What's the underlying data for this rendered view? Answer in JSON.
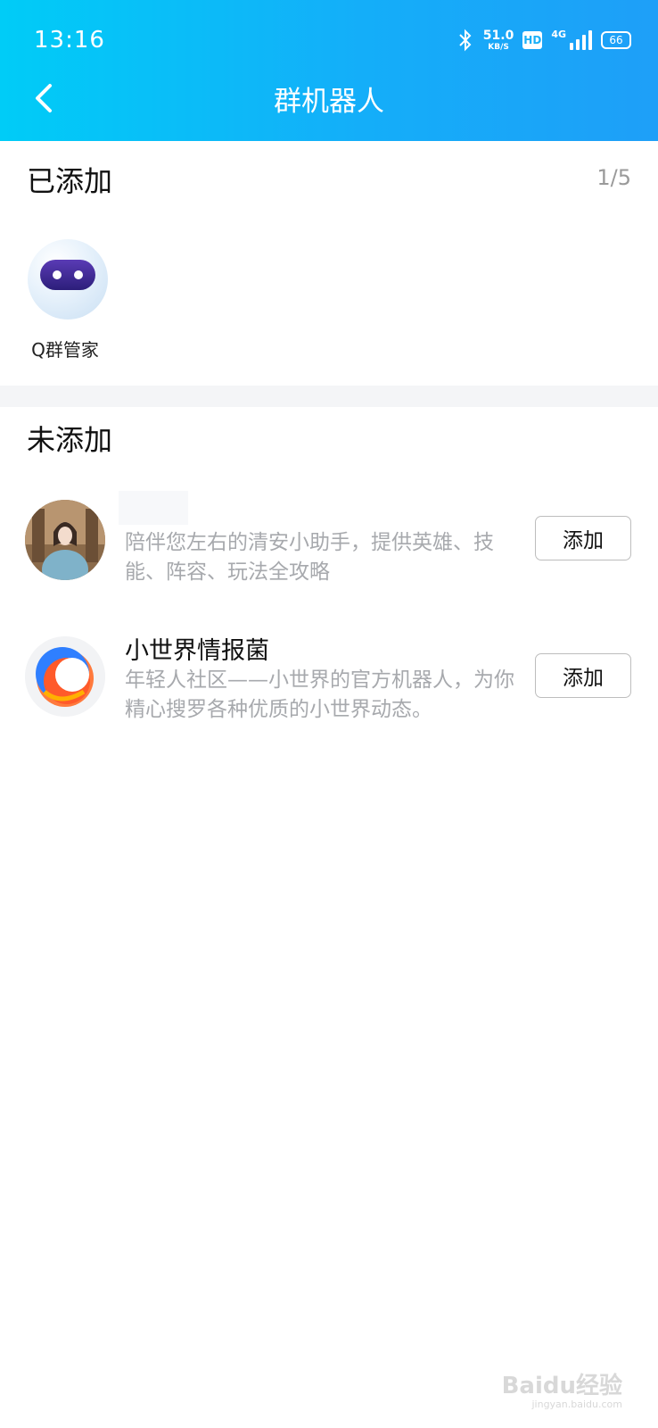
{
  "status_bar": {
    "time": "13:16",
    "net_speed": "51.0",
    "net_unit": "KB/S",
    "hd": "HD",
    "network": "4G",
    "battery": "66"
  },
  "nav": {
    "title": "群机器人"
  },
  "added": {
    "title": "已添加",
    "count": "1/5",
    "bots": [
      {
        "name": "Q群管家"
      }
    ]
  },
  "not_added": {
    "title": "未添加",
    "bots": [
      {
        "name": "",
        "desc": "陪伴您左右的清安小助手，提供英雄、技能、阵容、玩法全攻略",
        "button": "添加"
      },
      {
        "name": "小世界情报菌",
        "desc": "年轻人社区——小世界的官方机器人，为你精心搜罗各种优质的小世界动态。",
        "button": "添加"
      }
    ]
  },
  "watermark": {
    "brand": "Baidu经验",
    "url": "jingyan.baidu.com"
  },
  "colors": {
    "header_start": "#00ccf7",
    "header_end": "#1e9ff8",
    "desc_gray": "#a7a9ad"
  }
}
